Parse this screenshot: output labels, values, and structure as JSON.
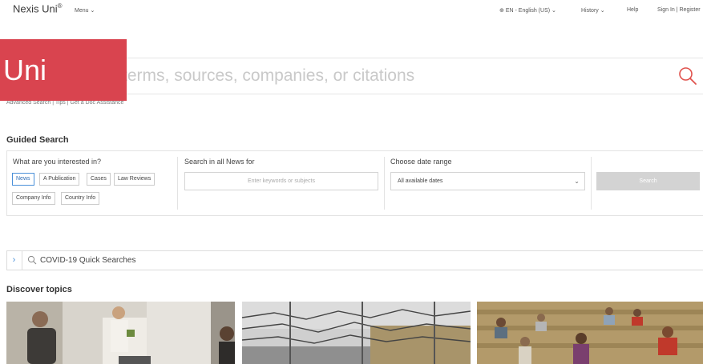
{
  "header": {
    "logo_text": "Nexis Uni",
    "logo_mark": "®",
    "menu_label": "Menu",
    "language": "EN - English (US)",
    "history": "History",
    "help": "Help",
    "sign_in": "Sign In | Register"
  },
  "badge_text": "Uni",
  "search": {
    "placeholder": "Enter terms, sources, companies, or citations",
    "links": "Advanced Search | Tips | Get a Doc Assistance"
  },
  "guided": {
    "title": "Guided Search",
    "interest_label": "What are you interested in?",
    "chips": [
      "News",
      "A Publication",
      "Cases",
      "Law Reviews",
      "Company Info",
      "Country Info"
    ],
    "active_chip": "News",
    "keywords_label": "Search in all News for",
    "keywords_placeholder": "Enter keywords or subjects",
    "date_label": "Choose date range",
    "date_value": "All available dates",
    "search_button": "Search"
  },
  "covid": {
    "label": "COVID-19 Quick Searches"
  },
  "discover": {
    "title": "Discover topics"
  },
  "colors": {
    "badge": "#d9444f",
    "search_icon": "#e0524d",
    "active_chip": "#4a90d9"
  }
}
